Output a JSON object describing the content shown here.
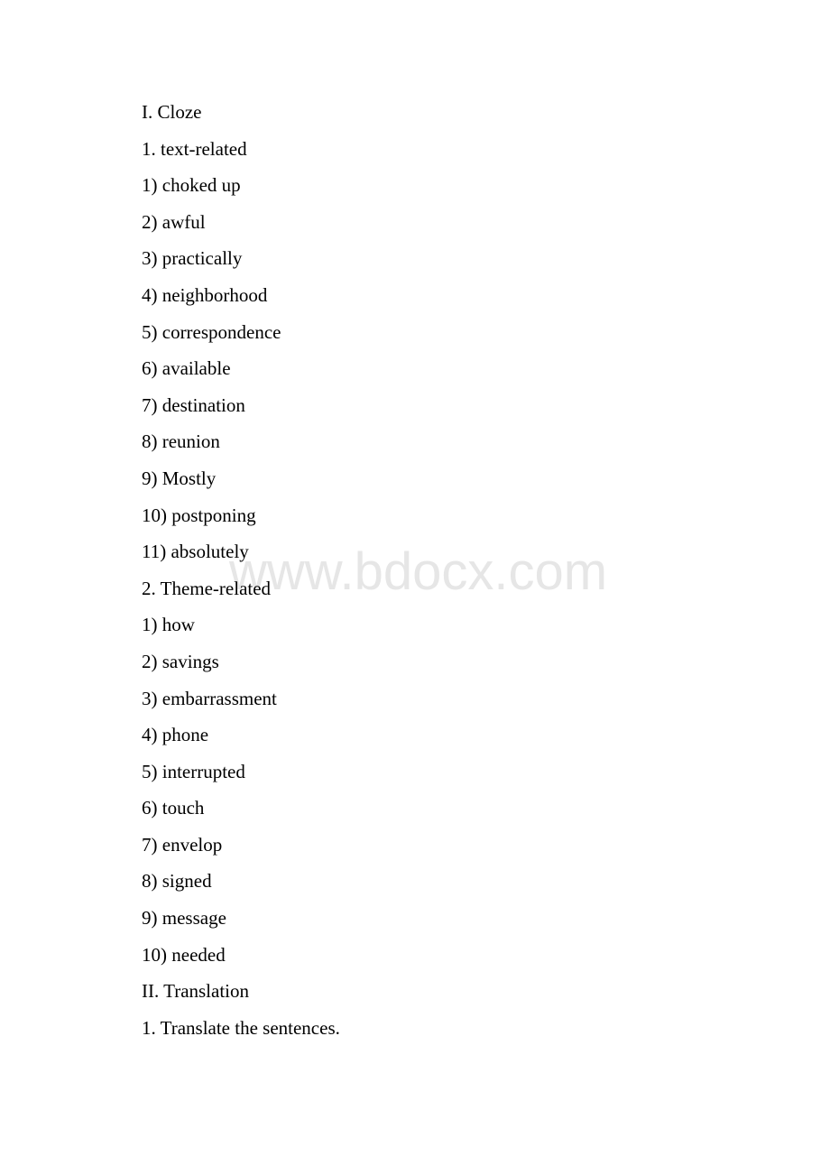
{
  "watermark": "www.bdocx.com",
  "lines": [
    "I. Cloze",
    "1. text-related",
    "1) choked up",
    "2) awful",
    "3) practically",
    "4) neighborhood",
    "5) correspondence",
    "6) available",
    "7) destination",
    "8) reunion",
    "9) Mostly",
    "10) postponing",
    "11) absolutely",
    "2. Theme-related",
    "1) how",
    "2) savings",
    "3) embarrassment",
    "4) phone",
    "5) interrupted",
    "6) touch",
    "7) envelop",
    "8) signed",
    "9) message",
    "10) needed",
    "II. Translation",
    "1. Translate the sentences."
  ]
}
